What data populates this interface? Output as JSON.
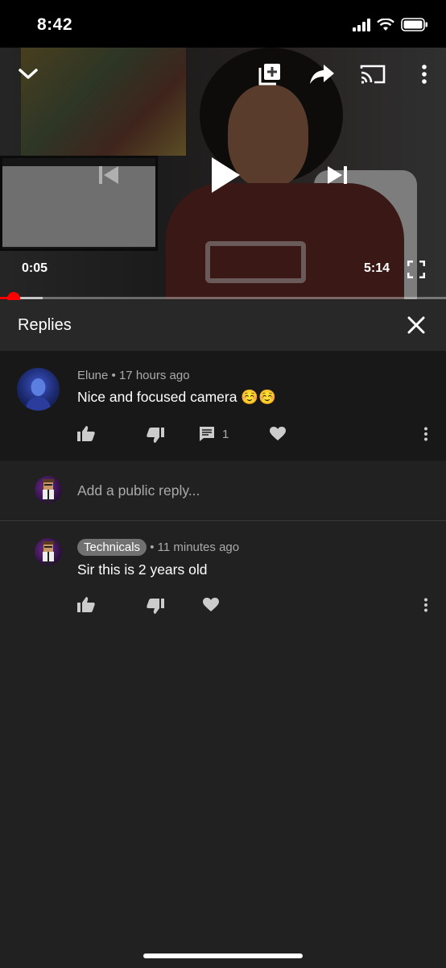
{
  "status_bar": {
    "time": "8:42",
    "icons": [
      "signal-icon",
      "wifi-icon",
      "battery-icon"
    ]
  },
  "player": {
    "current_time": "0:05",
    "duration": "5:14",
    "progress_fraction": 0.016,
    "buffered_fraction": 0.095,
    "controls": [
      "collapse-icon",
      "add-to-playlist-icon",
      "share-icon",
      "cast-icon",
      "more-vert-icon",
      "previous-icon",
      "play-icon",
      "next-icon",
      "fullscreen-icon"
    ]
  },
  "replies_panel": {
    "title": "Replies",
    "parent_comment": {
      "author": "Elune",
      "age": "17 hours ago",
      "text": "Nice and focused camera ☺️☺️",
      "reply_count": "1"
    },
    "reply_input": {
      "placeholder": "Add a public reply..."
    },
    "replies": [
      {
        "author": "Technicals",
        "age": "11 minutes ago",
        "text": "Sir this is 2 years old"
      }
    ]
  },
  "colors": {
    "accent": "#ff0000",
    "background": "#212121",
    "highlight": "#181818"
  }
}
